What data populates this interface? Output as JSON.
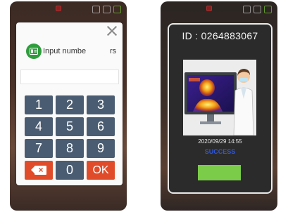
{
  "left_screen": {
    "dialog": {
      "title": "Input numbe",
      "title_tail": "rs",
      "close_icon": "close-icon",
      "id_icon": "id-card-icon"
    },
    "input_value": "",
    "keys": [
      "1",
      "2",
      "3",
      "4",
      "5",
      "6",
      "7",
      "8",
      "9",
      "backspace",
      "0",
      "OK"
    ],
    "colors": {
      "key": "#4a5c71",
      "accent_key": "#e04c2a",
      "badge": "#2e9d3c"
    }
  },
  "right_screen": {
    "id_label": "ID : 0264883067",
    "datetime": "2020/09/29 14:55",
    "status": "SUCCESS",
    "colors": {
      "status": "#2f56d9",
      "button": "#7bcc48"
    }
  }
}
